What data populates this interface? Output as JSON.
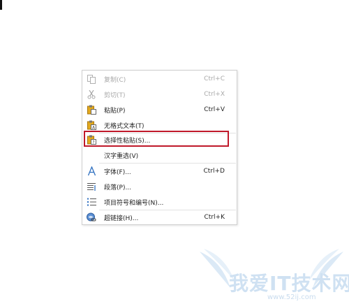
{
  "context_menu": {
    "items": [
      {
        "label": "复制(C)",
        "shortcut": "Ctrl+C",
        "icon": "copy-icon",
        "enabled": false
      },
      {
        "label": "剪切(T)",
        "shortcut": "Ctrl+X",
        "icon": "scissors-icon",
        "enabled": false
      },
      {
        "label": "粘贴(P)",
        "shortcut": "Ctrl+V",
        "icon": "paste-icon",
        "enabled": true
      },
      {
        "label": "无格式文本(T)",
        "shortcut": "",
        "icon": "paste-plain-text-icon",
        "enabled": true
      },
      {
        "label": "选择性粘贴(S)...",
        "shortcut": "",
        "icon": "paste-special-icon",
        "enabled": true,
        "highlighted": true
      },
      {
        "label": "汉字重选(V)",
        "shortcut": "",
        "icon": "",
        "enabled": true
      },
      {
        "label": "字体(F)...",
        "shortcut": "Ctrl+D",
        "icon": "font-icon",
        "enabled": true
      },
      {
        "label": "段落(P)...",
        "shortcut": "",
        "icon": "paragraph-icon",
        "enabled": true
      },
      {
        "label": "项目符号和编号(N)...",
        "shortcut": "",
        "icon": "bullet-list-icon",
        "enabled": true
      },
      {
        "label": "超链接(H)...",
        "shortcut": "Ctrl+K",
        "icon": "hyperlink-icon",
        "enabled": true
      }
    ],
    "highlight_color": "#c0192a"
  },
  "watermark": {
    "title": "我爱IT技术网",
    "url": "www.52ij.com"
  }
}
